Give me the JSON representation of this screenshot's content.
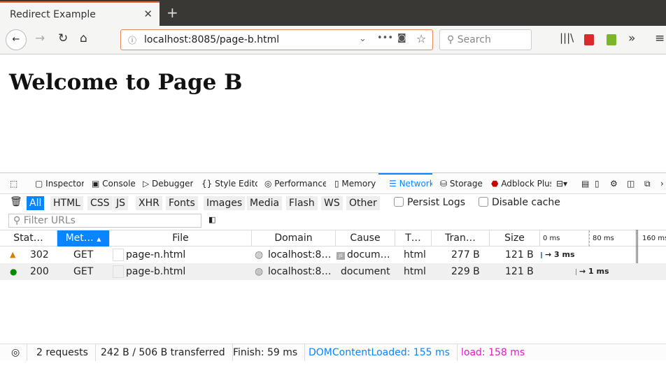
{
  "browser": {
    "tab_title": "Redirect Example",
    "url": "localhost:8085/page-b.html",
    "search_placeholder": "Search"
  },
  "page": {
    "heading": "Welcome to Page B"
  },
  "devtools": {
    "tools": [
      "Inspector",
      "Console",
      "Debugger",
      "Style Editor",
      "Performance",
      "Memory",
      "Network",
      "Storage",
      "Adblock Plus"
    ],
    "selected_tool": "Network",
    "filters": [
      "All",
      "HTML",
      "CSS",
      "JS",
      "XHR",
      "Fonts",
      "Images",
      "Media",
      "Flash",
      "WS",
      "Other"
    ],
    "persist_logs": "Persist Logs",
    "disable_cache": "Disable cache",
    "filter_placeholder": "Filter URLs",
    "columns": [
      "Stat…",
      "Met…",
      "File",
      "Domain",
      "Cause",
      "T…",
      "Tran…",
      "Size"
    ],
    "waterfall_ticks": [
      "0 ms",
      "80 ms",
      "160 ms"
    ],
    "rows": [
      {
        "status": "302",
        "status_color": "#d97e00",
        "method": "GET",
        "file": "page-n.html",
        "domain": "localhost:8…",
        "cause": "docum…",
        "type": "html",
        "transferred": "277 B",
        "size": "121 B",
        "timing": "→ 3 ms"
      },
      {
        "status": "200",
        "status_color": "#058b00",
        "method": "GET",
        "file": "page-b.html",
        "domain": "localhost:8…",
        "cause": "document",
        "type": "html",
        "transferred": "229 B",
        "size": "121 B",
        "timing": "→ 1 ms"
      }
    ],
    "status": {
      "requests": "2 requests",
      "transferred": "242 B / 506 B transferred",
      "finish": "Finish: 59 ms",
      "dcl": "DOMContentLoaded: 155 ms",
      "load": "load: 158 ms"
    }
  }
}
